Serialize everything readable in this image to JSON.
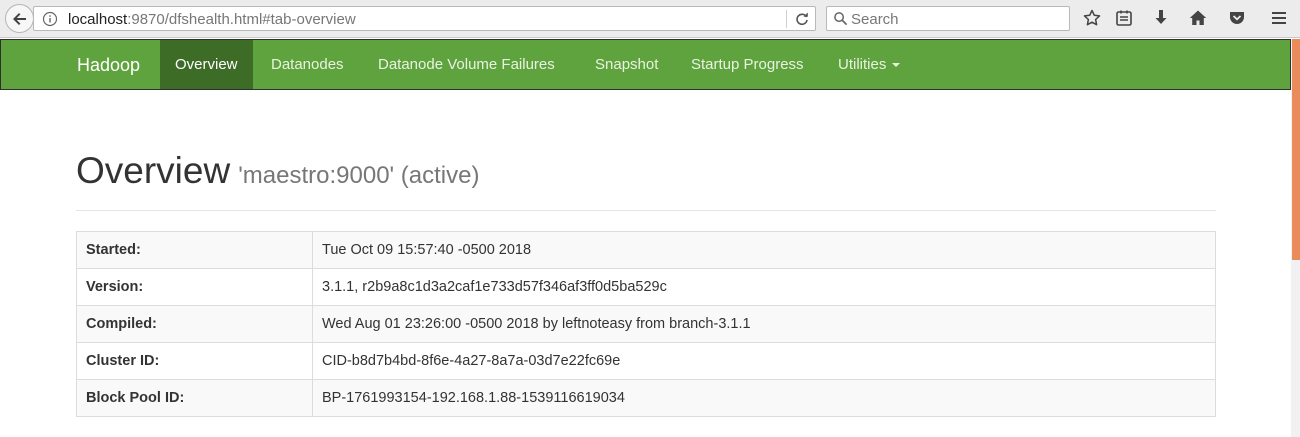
{
  "browser": {
    "url_host": "localhost",
    "url_rest": ":9870/dfshealth.html#tab-overview",
    "search_placeholder": "Search"
  },
  "navbar": {
    "brand": "Hadoop",
    "items": [
      {
        "label": "Overview",
        "active": true
      },
      {
        "label": "Datanodes"
      },
      {
        "label": "Datanode Volume Failures"
      },
      {
        "label": "Snapshot"
      },
      {
        "label": "Startup Progress"
      },
      {
        "label": "Utilities"
      }
    ]
  },
  "header": {
    "title": "Overview",
    "subtitle": "'maestro:9000' (active)"
  },
  "overview_table": [
    {
      "key": "Started:",
      "value": "Tue Oct 09 15:57:40 -0500 2018"
    },
    {
      "key": "Version:",
      "value": "3.1.1, r2b9a8c1d3a2caf1e733d57f346af3ff0d5ba529c"
    },
    {
      "key": "Compiled:",
      "value": "Wed Aug 01 23:26:00 -0500 2018 by leftnoteasy from branch-3.1.1"
    },
    {
      "key": "Cluster ID:",
      "value": "CID-b8d7b4bd-8f6e-4a27-8a7a-03d7e22fc69e"
    },
    {
      "key": "Block Pool ID:",
      "value": "BP-1761993154-192.168.1.88-1539116619034"
    }
  ],
  "colors": {
    "navbar": "#5fa33e",
    "navbar_active": "#3d6c27",
    "scrollbar_thumb": "#e98b5b"
  }
}
